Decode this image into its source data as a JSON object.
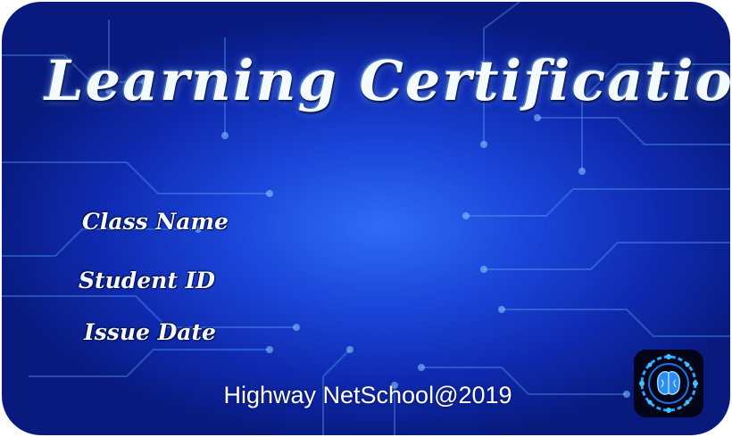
{
  "certificate": {
    "title": "Learning Certification",
    "fields": {
      "class_name_label": "Class Name",
      "student_id_label": "Student ID",
      "issue_date_label": "Issue Date"
    },
    "footer": "Highway NetSchool@2019",
    "logo_icon": "brain-network-icon"
  },
  "colors": {
    "background_center": "#2f6cf5",
    "background_edge": "#081a7e",
    "circuit_lines": "#5fb0ff",
    "text": "#ffffff"
  }
}
